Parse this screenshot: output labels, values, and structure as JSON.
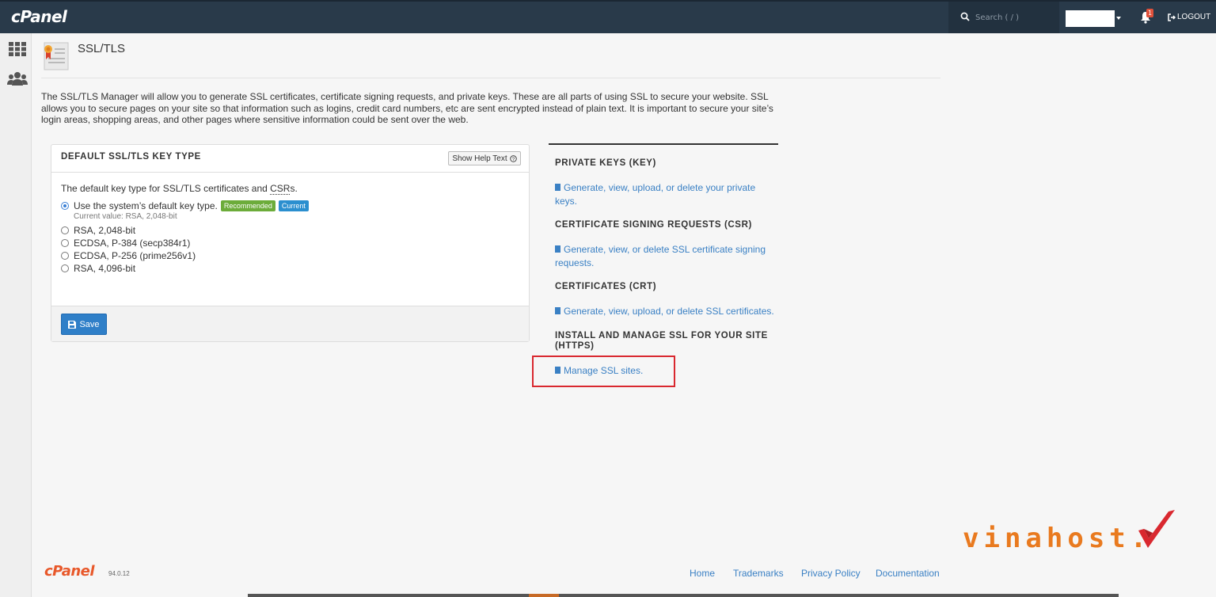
{
  "topbar": {
    "logo": "cPanel",
    "search_placeholder": "Search ( / )",
    "notification_count": "1",
    "logout_label": "LOGOUT"
  },
  "header": {
    "title": "SSL/TLS",
    "intro": "The SSL/TLS Manager will allow you to generate SSL certificates, certificate signing requests, and private keys. These are all parts of using SSL to secure your website. SSL allows you to secure pages on your site so that information such as logins, credit card numbers, etc are sent encrypted instead of plain text. It is important to secure your site’s login areas, shopping areas, and other pages where sensitive information could be sent over the web."
  },
  "panel": {
    "title": "DEFAULT SSL/TLS KEY TYPE",
    "help_button": "Show Help Text",
    "description_prefix": "The default key type for SSL/TLS certificates and ",
    "description_abbr": "CSR",
    "description_suffix": "s.",
    "options": [
      {
        "label": "Use the system’s default key type.",
        "selected": true
      },
      {
        "label": "RSA, 2,048-bit",
        "selected": false
      },
      {
        "label": "ECDSA, P-384 (secp384r1)",
        "selected": false
      },
      {
        "label": "ECDSA, P-256 (prime256v1)",
        "selected": false
      },
      {
        "label": "RSA, 4,096-bit",
        "selected": false
      }
    ],
    "badge_recommended": "Recommended",
    "badge_current": "Current",
    "current_value": "Current value: RSA, 2,048-bit",
    "save_label": "Save"
  },
  "sections": {
    "keys": {
      "heading": "PRIVATE KEYS (KEY)",
      "link_line1": "Generate, view, upload, or delete your private",
      "link_line2": "keys."
    },
    "csr": {
      "heading": "CERTIFICATE SIGNING REQUESTS (CSR)",
      "link_line1": "Generate, view, or delete SSL certificate signing",
      "link_line2": "requests."
    },
    "crt": {
      "heading": "CERTIFICATES (CRT)",
      "link": "Generate, view, upload, or delete SSL certificates."
    },
    "install": {
      "heading_line1": "INSTALL AND MANAGE SSL FOR YOUR SITE",
      "heading_line2": "(HTTPS)",
      "link": "Manage SSL sites."
    }
  },
  "footer": {
    "logo": "cPanel",
    "version": "94.0.12",
    "links": [
      "Home",
      "Trademarks",
      "Privacy Policy",
      "Documentation"
    ]
  },
  "watermark": "vinahost.",
  "colors": {
    "topbar": "#293a4a",
    "link": "#3a80c4",
    "primary": "#2f7fc8",
    "highlight": "#d9282f",
    "watermark": "#e97a1f"
  }
}
